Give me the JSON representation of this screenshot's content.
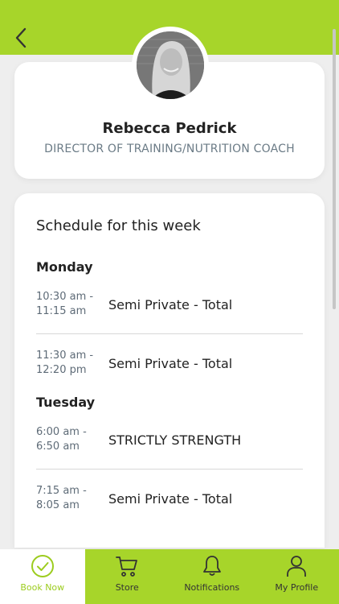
{
  "colors": {
    "accent": "#a7d52a",
    "background": "#eeeeee",
    "card": "#ffffff",
    "muted_text": "#6b7b86"
  },
  "header": {
    "back_icon": "chevron-left-icon"
  },
  "profile": {
    "name": "Rebecca Pedrick",
    "title": "DIRECTOR OF TRAINING/NUTRITION COACH"
  },
  "schedule": {
    "heading": "Schedule for this week",
    "days": [
      {
        "day": "Monday",
        "sessions": [
          {
            "start": "10:30 am -",
            "end": "11:15 am",
            "class": "Semi Private - Total"
          },
          {
            "start": "11:30 am -",
            "end": "12:20 pm",
            "class": "Semi Private - Total"
          }
        ]
      },
      {
        "day": "Tuesday",
        "sessions": [
          {
            "start": "6:00 am -",
            "end": "6:50 am",
            "class": "STRICTLY STRENGTH"
          },
          {
            "start": "7:15 am -",
            "end": "8:05 am",
            "class": "Semi Private - Total"
          }
        ]
      }
    ]
  },
  "tabbar": {
    "tabs": [
      {
        "label": "Book Now",
        "icon": "check-circle-icon",
        "active": true
      },
      {
        "label": "Store",
        "icon": "cart-icon",
        "active": false
      },
      {
        "label": "Notifications",
        "icon": "bell-icon",
        "active": false
      },
      {
        "label": "My Profile",
        "icon": "user-icon",
        "active": false
      }
    ]
  }
}
